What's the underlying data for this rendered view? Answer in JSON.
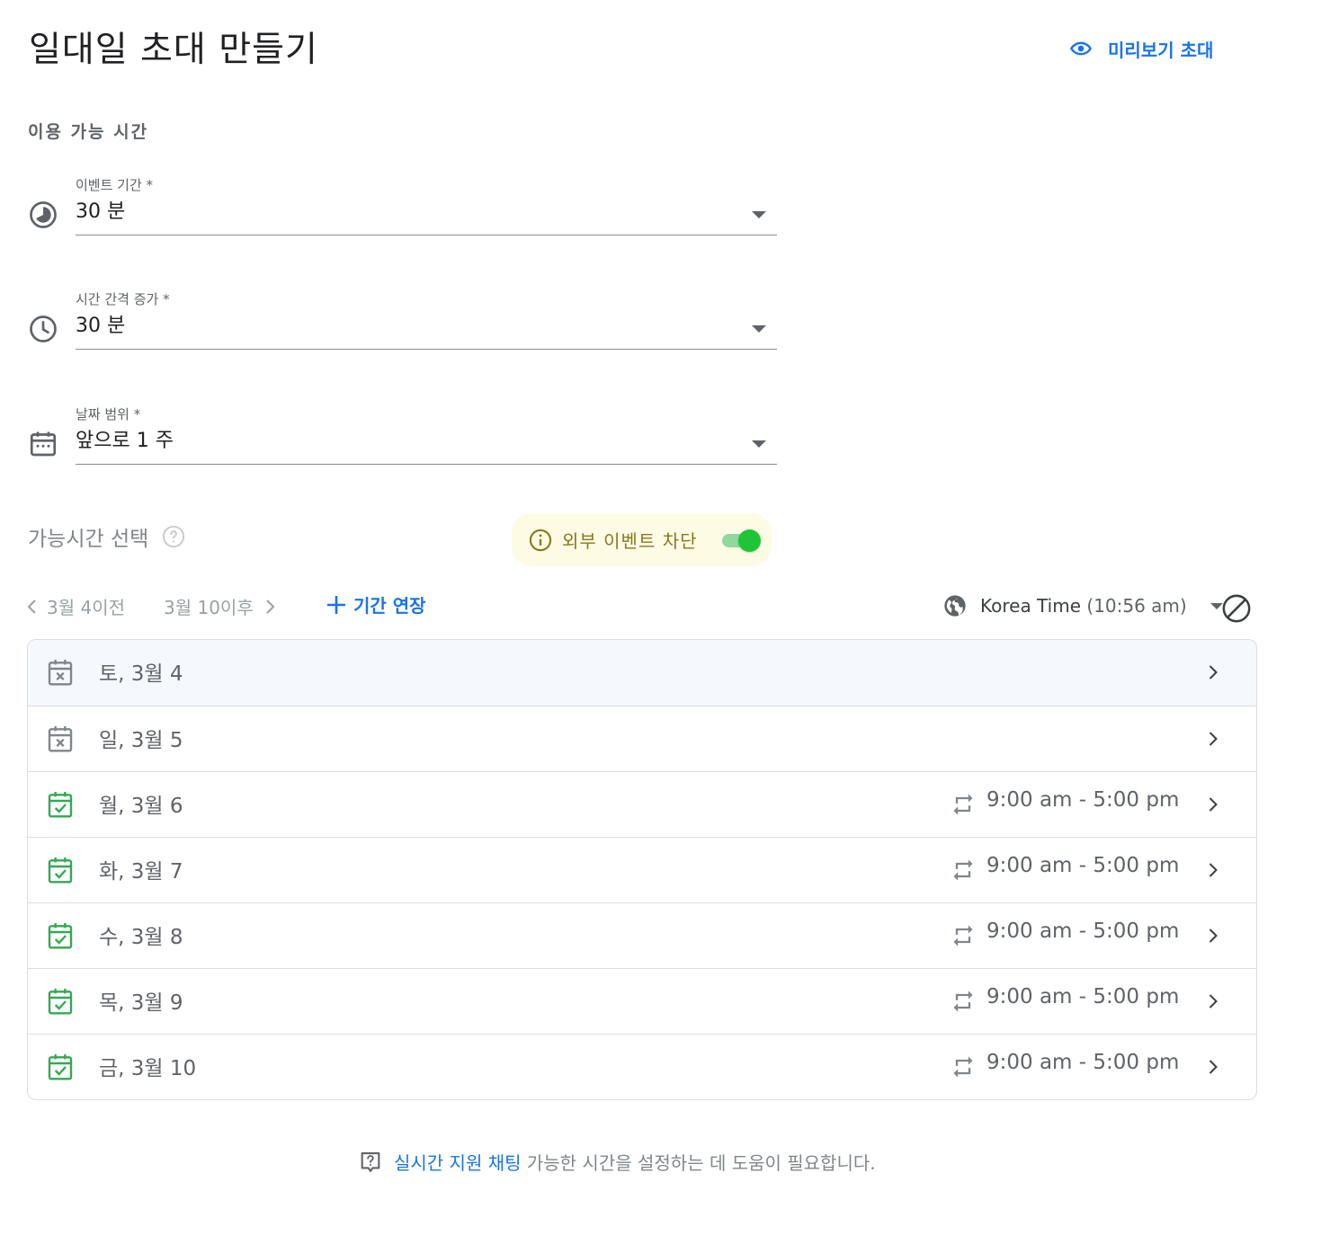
{
  "header": {
    "title": "일대일 초대 만들기",
    "preview_label": "미리보기 초대"
  },
  "availability": {
    "section_label": "이용 가능 시간",
    "fields": [
      {
        "label": "이벤트 기간 *",
        "value": "30 분",
        "icon": "timelapse-icon"
      },
      {
        "label": "시간 간격 증가 *",
        "value": "30 분",
        "icon": "clock-icon"
      },
      {
        "label": "날짜 범위 *",
        "value": "앞으로 1 주",
        "icon": "calendar-icon"
      }
    ]
  },
  "selection": {
    "title": "가능시간 선택",
    "block_external_label": "외부 이벤트 차단",
    "block_external_on": true
  },
  "nav": {
    "prev_label": "3월 4이전",
    "next_label": "3월 10이후",
    "extend_label": "기간 연장",
    "timezone_name": "Korea Time",
    "timezone_time": "(10:56 am)"
  },
  "days": [
    {
      "label": "토, 3월 4",
      "available": false,
      "time": ""
    },
    {
      "label": "일, 3월 5",
      "available": false,
      "time": ""
    },
    {
      "label": "월, 3월 6",
      "available": true,
      "time": "9:00 am - 5:00 pm"
    },
    {
      "label": "화, 3월 7",
      "available": true,
      "time": "9:00 am - 5:00 pm"
    },
    {
      "label": "수, 3월 8",
      "available": true,
      "time": "9:00 am - 5:00 pm"
    },
    {
      "label": "목, 3월 9",
      "available": true,
      "time": "9:00 am - 5:00 pm"
    },
    {
      "label": "금, 3월 10",
      "available": true,
      "time": "9:00 am - 5:00 pm"
    }
  ],
  "footer": {
    "chat_link": "실시간 지원 채팅",
    "help_text": "가능한 시간을 설정하는 데 도움이 필요합니다."
  },
  "colors": {
    "accent": "#1a73e8",
    "available": "#34a853",
    "unavailable": "#80868b",
    "toggle_on": "#1ec635"
  }
}
